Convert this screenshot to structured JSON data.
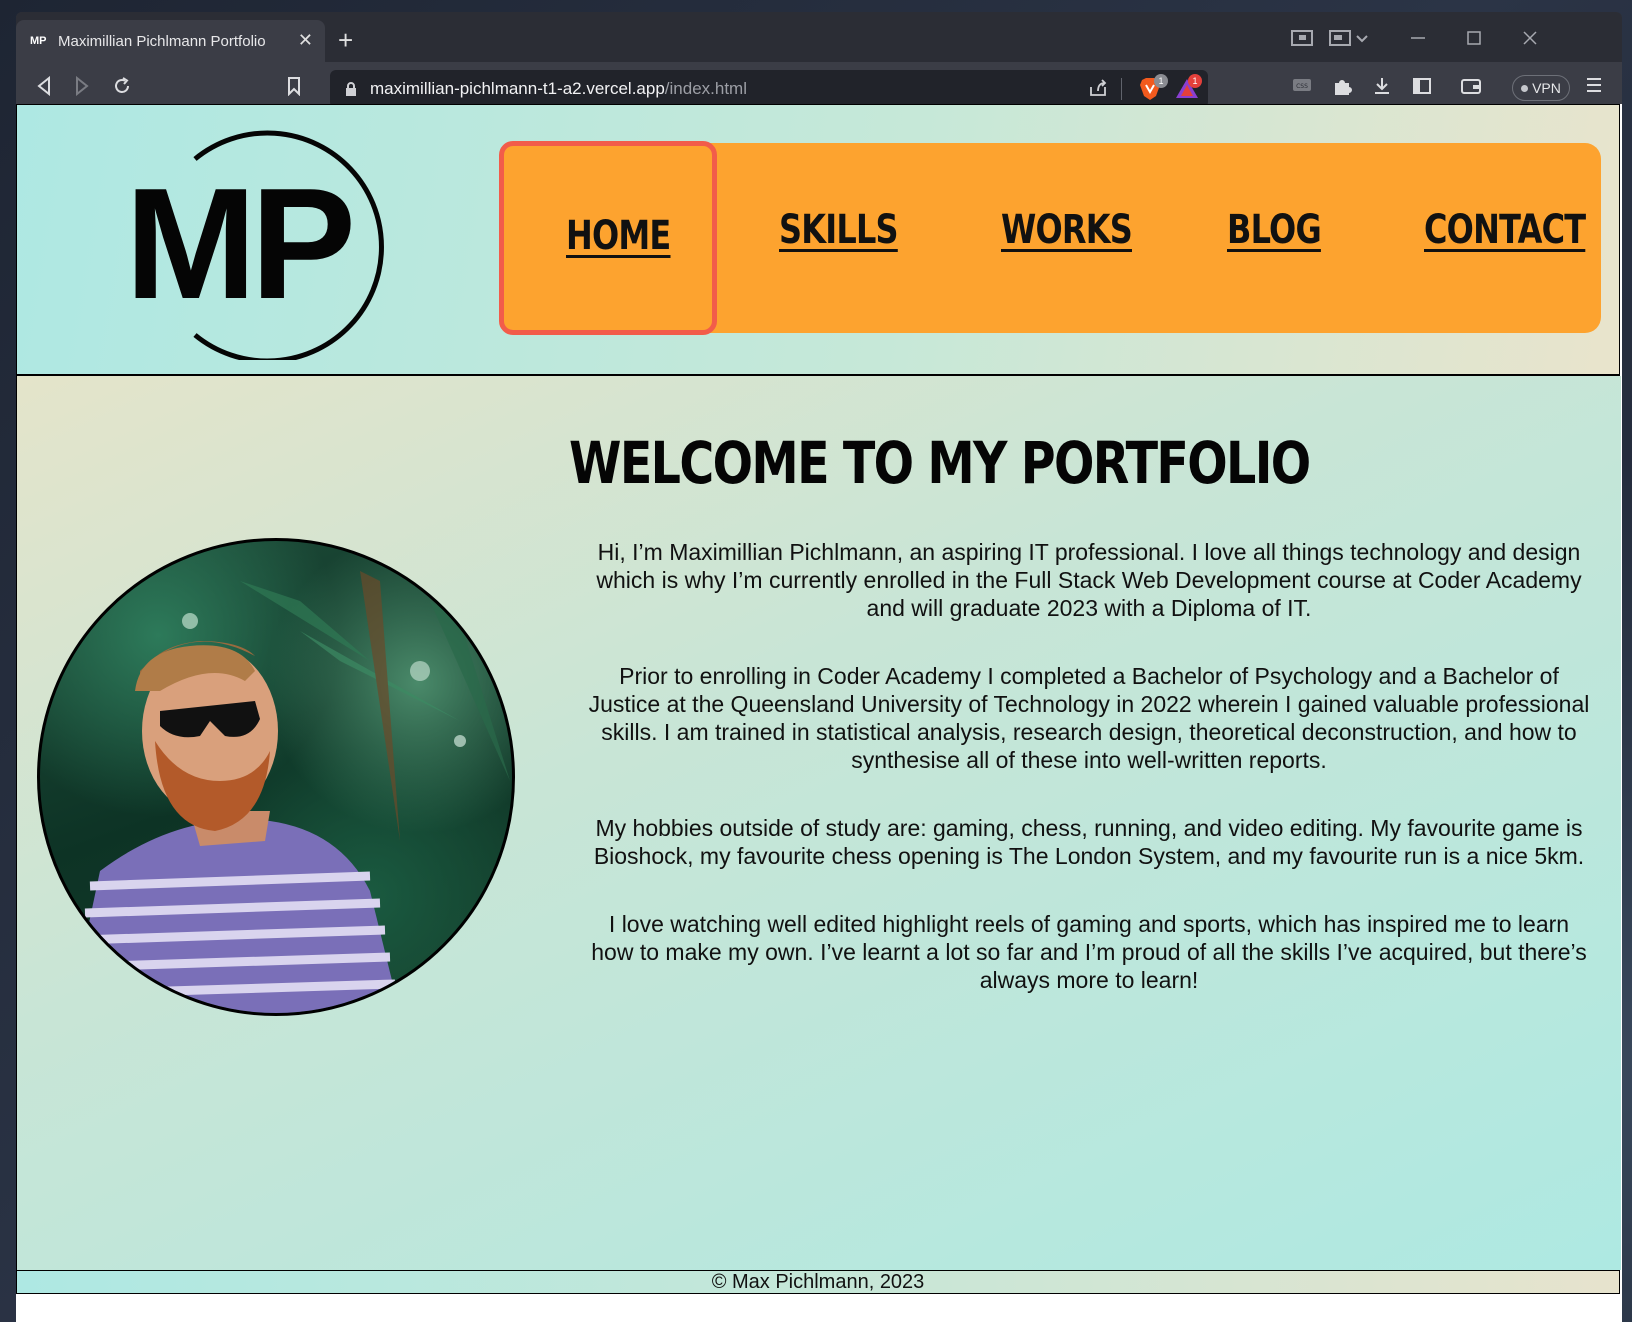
{
  "browser": {
    "tab": {
      "favicon": "MP",
      "title": "Maximillian Pichlmann Portfolio",
      "close": "✕"
    },
    "new_tab": "+",
    "url_host": "maximillian-pichlmann-t1-a2.vercel.app",
    "url_path": "/index.html",
    "brave_badge": "1",
    "rewards_badge": "1",
    "vpn_label": "VPN"
  },
  "site": {
    "logo": "MP",
    "nav": [
      {
        "label": "HOME"
      },
      {
        "label": "SKILLS"
      },
      {
        "label": "WORKS"
      },
      {
        "label": "BLOG"
      },
      {
        "label": "CONTACT"
      }
    ],
    "heading": "WELCOME TO MY PORTFOLIO",
    "bio": [
      "Hi, I’m Maximillian Pichlmann, an aspiring IT professional. I love all things technology and design which is why I’m currently enrolled in the Full Stack Web Development course at Coder Academy and will graduate 2023 with a Diploma of IT.",
      "Prior to enrolling in Coder Academy I completed a Bachelor of Psychology and a Bachelor of Justice at the Queensland University of Technology in 2022 wherein I gained valuable professional skills. I am trained in statistical analysis, research design, theoretical deconstruction, and how to synthesise all of these into well-written reports.",
      "My hobbies outside of study are: gaming, chess, running, and video editing. My favourite game is Bioshock, my favourite chess opening is The London System, and my favourite run is a nice 5km.",
      "I love watching well edited highlight reels of gaming and sports, which has inspired me to learn how to make my own. I’ve learnt a lot so far and I’m proud of all the skills I’ve acquired, but there’s always more to learn!"
    ],
    "footer": "© Max Pichlmann, 2023"
  },
  "colors": {
    "nav_bg": "#fda32f",
    "active_border": "#f25c4a",
    "gradient_teal": "#aee8e3",
    "gradient_cream": "#e9e4cc"
  },
  "icons": [
    "back-icon",
    "forward-icon",
    "reload-icon",
    "bookmark-icon",
    "lock-icon",
    "share-icon",
    "brave-shields-icon",
    "brave-rewards-icon",
    "css-icon",
    "extensions-icon",
    "download-icon",
    "sidebar-icon",
    "wallet-icon",
    "menu-icon"
  ]
}
